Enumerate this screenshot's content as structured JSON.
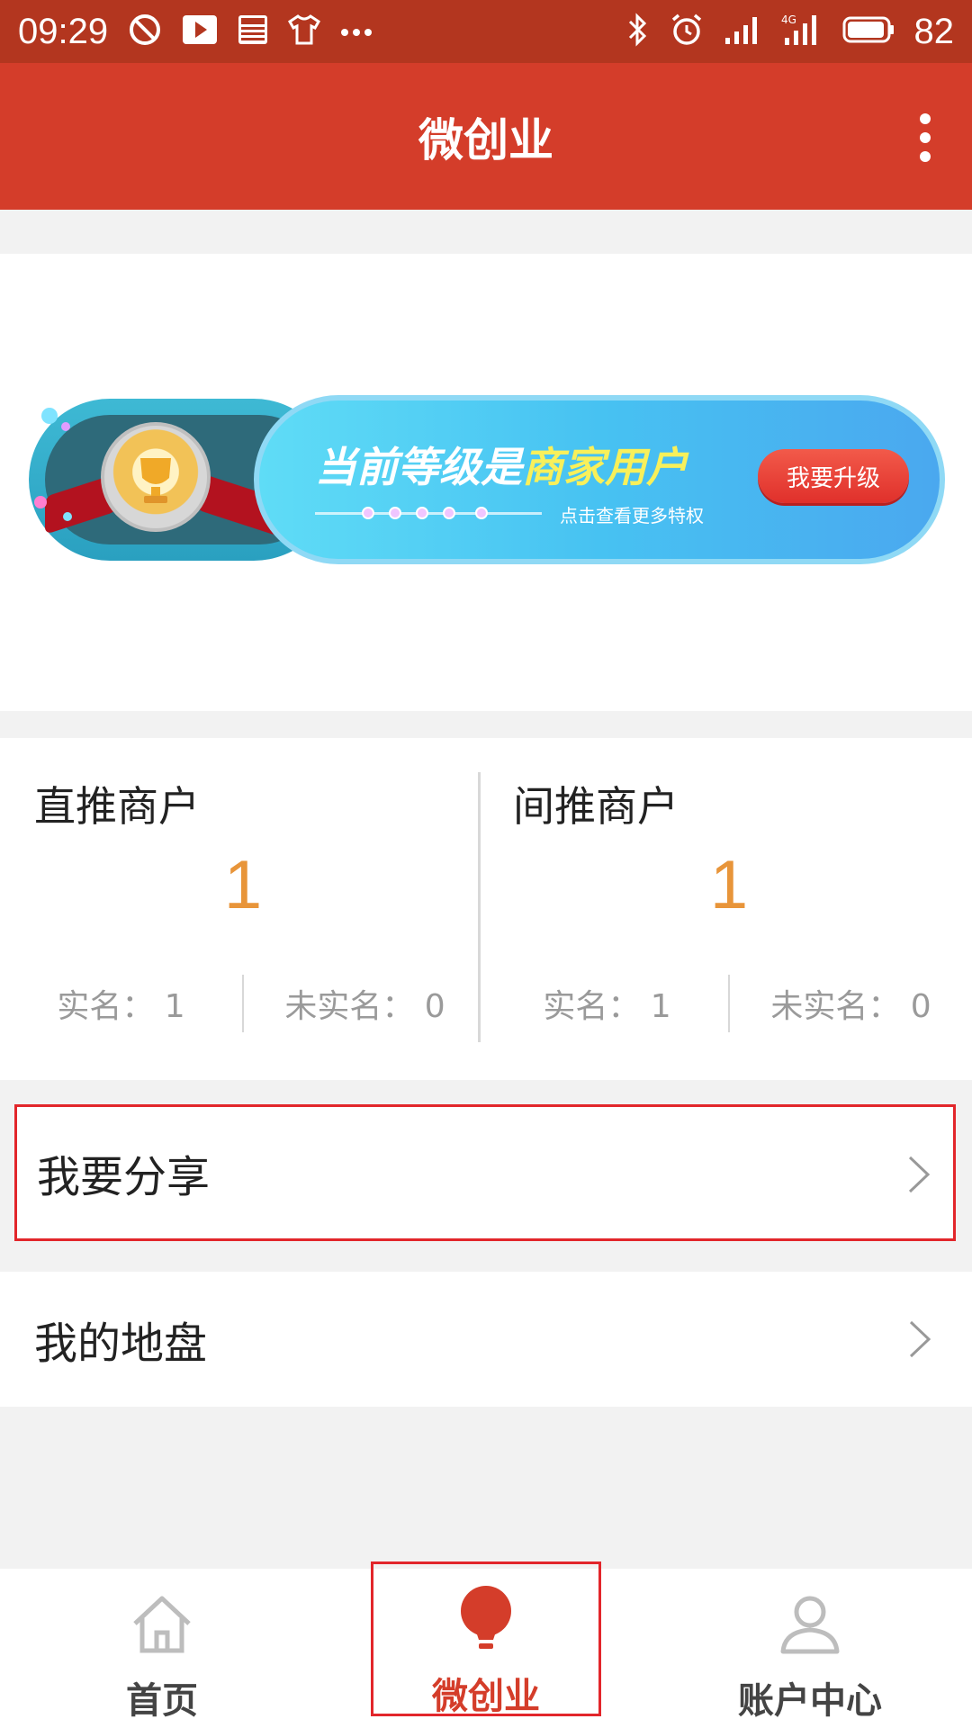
{
  "status_bar": {
    "time": "09:29",
    "battery": "82",
    "network": "4G"
  },
  "app_bar": {
    "title": "微创业"
  },
  "banner": {
    "headline_prefix": "当前等级是",
    "headline_level": "商家用户",
    "subtitle": "点击查看更多特权",
    "upgrade_button": "我要升级"
  },
  "stats": {
    "direct": {
      "label": "直推商户",
      "count": "1",
      "verified_label": "实名：",
      "verified_value": "1",
      "unverified_label": "未实名：",
      "unverified_value": "0"
    },
    "indirect": {
      "label": "间推商户",
      "count": "1",
      "verified_label": "实名：",
      "verified_value": "1",
      "unverified_label": "未实名：",
      "unverified_value": "0"
    }
  },
  "menu": {
    "share": "我要分享",
    "territory": "我的地盘"
  },
  "bottom_nav": {
    "items": [
      {
        "label": "首页",
        "icon": "home-icon"
      },
      {
        "label": "微创业",
        "icon": "lightbulb-icon"
      },
      {
        "label": "账户中心",
        "icon": "user-icon"
      }
    ],
    "active": "微创业"
  },
  "colors": {
    "primary": "#d43d2a",
    "status_bar": "#b3361f",
    "count": "#e8953a",
    "highlight_border": "#e2262b"
  }
}
